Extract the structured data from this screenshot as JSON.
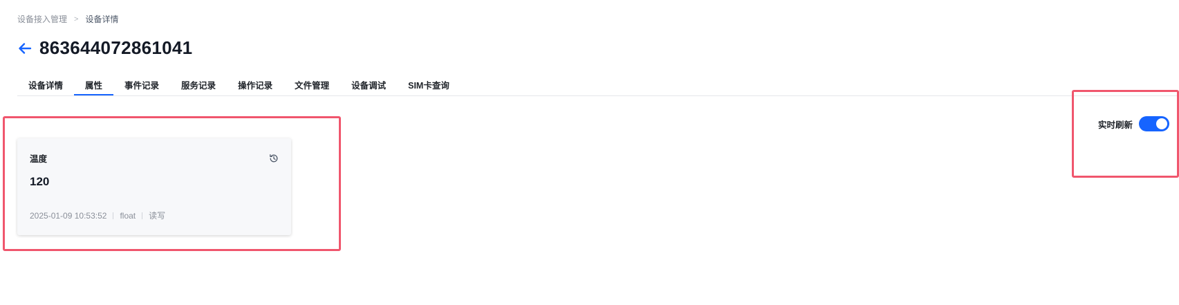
{
  "breadcrumb": {
    "parent": "设备接入管理",
    "separator": ">",
    "current": "设备详情"
  },
  "header": {
    "back_icon": "arrow-left-icon",
    "title": "863644072861041"
  },
  "tabs": [
    {
      "label": "设备详情",
      "active": false
    },
    {
      "label": "属性",
      "active": true
    },
    {
      "label": "事件记录",
      "active": false
    },
    {
      "label": "服务记录",
      "active": false
    },
    {
      "label": "操作记录",
      "active": false
    },
    {
      "label": "文件管理",
      "active": false
    },
    {
      "label": "设备调试",
      "active": false
    },
    {
      "label": "SIM卡查询",
      "active": false
    }
  ],
  "property_card": {
    "name": "温度",
    "value": "120",
    "timestamp": "2025-01-09 10:53:52",
    "data_type": "float",
    "access": "读写",
    "history_icon": "history-icon"
  },
  "realtime_refresh": {
    "label": "实时刷新",
    "enabled": true
  },
  "colors": {
    "accent": "#1664ff",
    "annotation": "#f0566d"
  }
}
